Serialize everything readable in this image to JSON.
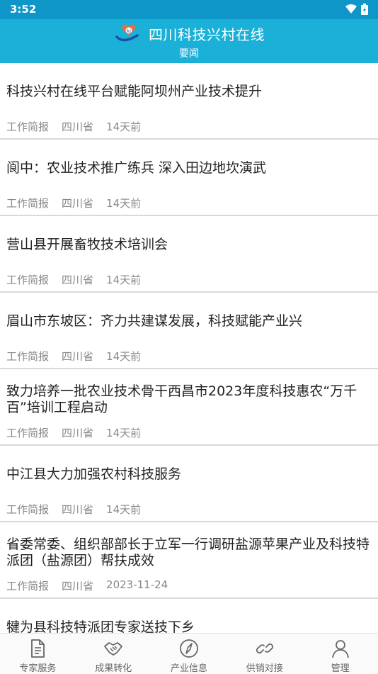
{
  "status": {
    "time": "3:52"
  },
  "header": {
    "title": "四川科技兴村在线",
    "subtitle": "要闻"
  },
  "articles": [
    {
      "title": "科技兴村在线平台赋能阿坝州产业技术提升",
      "category": "工作简报",
      "region": "四川省",
      "time": "14天前"
    },
    {
      "title": "阆中：农业技术推广练兵  深入田边地坎演武",
      "category": "工作简报",
      "region": "四川省",
      "time": "14天前"
    },
    {
      "title": "营山县开展畜牧技术培训会",
      "category": "工作简报",
      "region": "四川省",
      "time": "14天前"
    },
    {
      "title": "眉山市东坡区：齐力共建谋发展，科技赋能产业兴",
      "category": "工作简报",
      "region": "四川省",
      "time": "14天前"
    },
    {
      "title": "致力培养一批农业技术骨干西昌市2023年度科技惠农“万千百”培训工程启动",
      "category": "工作简报",
      "region": "四川省",
      "time": "14天前"
    },
    {
      "title": "中江县大力加强农村科技服务",
      "category": "工作简报",
      "region": "四川省",
      "time": "14天前"
    },
    {
      "title": "省委常委、组织部部长于立军一行调研盐源苹果产业及科技特派团（盐源团）帮扶成效",
      "category": "工作简报",
      "region": "四川省",
      "time": "2023-11-24"
    },
    {
      "title": "犍为县科技特派团专家送技下乡",
      "category": "",
      "region": "",
      "time": ""
    }
  ],
  "tabbar": [
    {
      "label": "专家服务",
      "icon": "document-icon"
    },
    {
      "label": "成果转化",
      "icon": "handshake-icon"
    },
    {
      "label": "产业信息",
      "icon": "compass-icon"
    },
    {
      "label": "供销对接",
      "icon": "link-icon"
    },
    {
      "label": "管理",
      "icon": "user-icon"
    }
  ],
  "colors": {
    "status_bar": "#0f96c9",
    "header": "#1bb0d8"
  }
}
